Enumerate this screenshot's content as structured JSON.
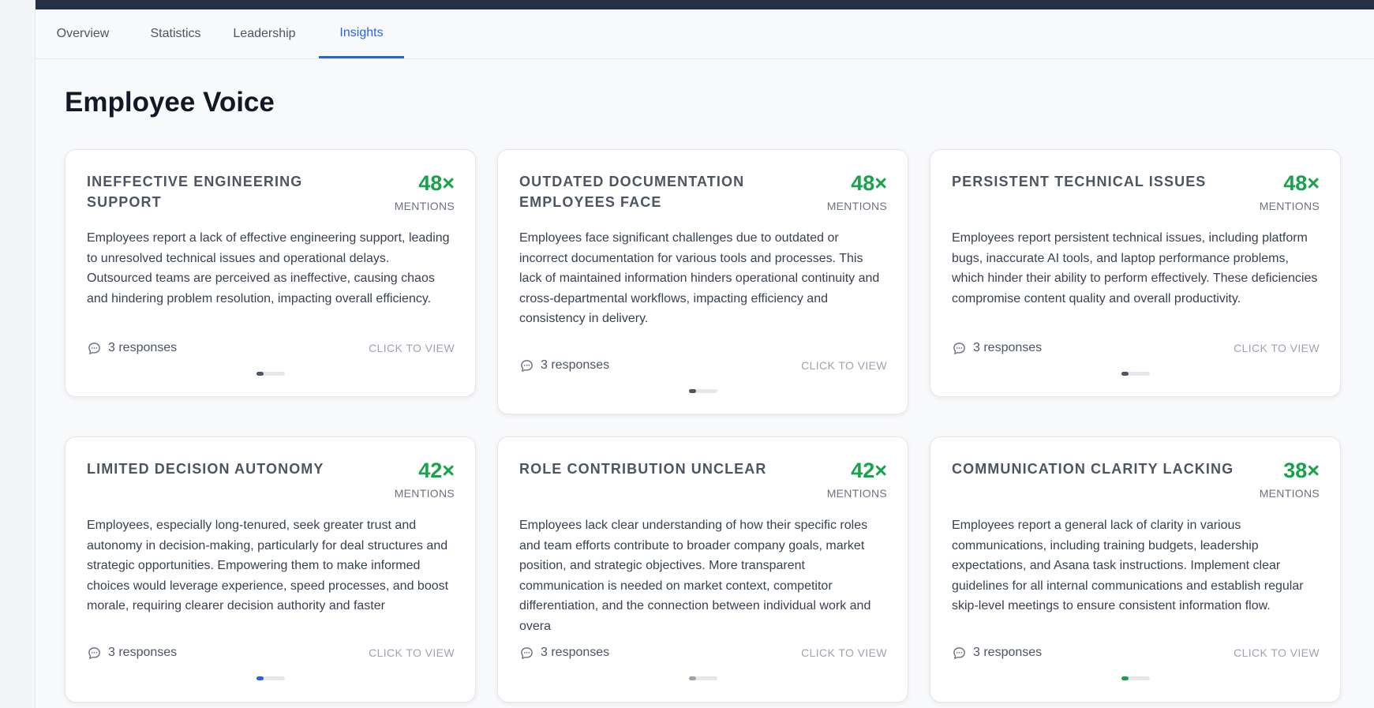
{
  "tabs": [
    {
      "label": "Overview"
    },
    {
      "label": "Statistics"
    },
    {
      "label": "Leadership"
    },
    {
      "label": "Insights"
    }
  ],
  "page_title": "Employee Voice",
  "colors": {
    "accent": "#2563eb",
    "count_green": "#16a34a",
    "indicator_dark": "#4b5563",
    "indicator_gray": "#9ca3af",
    "indicator_blue": "#2563eb",
    "indicator_green": "#16a34a"
  },
  "icons": {
    "responses": "chat-bubble-icon"
  },
  "cards": [
    {
      "title": "INEFFECTIVE ENGINEERING SUPPORT",
      "count": "48×",
      "mentions_label": "MENTIONS",
      "description": "Employees report a lack of effective engineering support, leading to unresolved technical issues and operational delays. Outsourced teams are perceived as ineffective, causing chaos and hindering problem resolution, impacting overall efficiency.",
      "responses": "3 responses",
      "cta": "CLICK TO VIEW",
      "indicator": "dark"
    },
    {
      "title": "OUTDATED DOCUMENTATION EMPLOYEES FACE",
      "count": "48×",
      "mentions_label": "MENTIONS",
      "description": "Employees face significant challenges due to outdated or incorrect documentation for various tools and processes. This lack of maintained information hinders operational continuity and cross-departmental workflows, impacting efficiency and consistency in delivery.",
      "responses": "3 responses",
      "cta": "CLICK TO VIEW",
      "indicator": "dark"
    },
    {
      "title": "PERSISTENT TECHNICAL ISSUES",
      "count": "48×",
      "mentions_label": "MENTIONS",
      "description": "Employees report persistent technical issues, including platform bugs, inaccurate AI tools, and laptop performance problems, which hinder their ability to perform effectively. These deficiencies compromise content quality and overall productivity.",
      "responses": "3 responses",
      "cta": "CLICK TO VIEW",
      "indicator": "dark"
    },
    {
      "title": "LIMITED DECISION AUTONOMY",
      "count": "42×",
      "mentions_label": "MENTIONS",
      "description": "Employees, especially long-tenured, seek greater trust and autonomy in decision-making, particularly for deal structures and strategic opportunities. Empowering them to make informed choices would leverage experience, speed processes, and boost morale, requiring clearer decision authority and faster",
      "responses": "3 responses",
      "cta": "CLICK TO VIEW",
      "indicator": "blue"
    },
    {
      "title": "ROLE CONTRIBUTION UNCLEAR",
      "count": "42×",
      "mentions_label": "MENTIONS",
      "description": "Employees lack clear understanding of how their specific roles and team efforts contribute to broader company goals, market position, and strategic objectives. More transparent communication is needed on market context, competitor differentiation, and the connection between individual work and overa",
      "responses": "3 responses",
      "cta": "CLICK TO VIEW",
      "indicator": "gray"
    },
    {
      "title": "COMMUNICATION CLARITY LACKING",
      "count": "38×",
      "mentions_label": "MENTIONS",
      "description": "Employees report a general lack of clarity in various communications, including training budgets, leadership expectations, and Asana task instructions. Implement clear guidelines for all internal communications and establish regular skip-level meetings to ensure consistent information flow.",
      "responses": "3 responses",
      "cta": "CLICK TO VIEW",
      "indicator": "green"
    }
  ]
}
